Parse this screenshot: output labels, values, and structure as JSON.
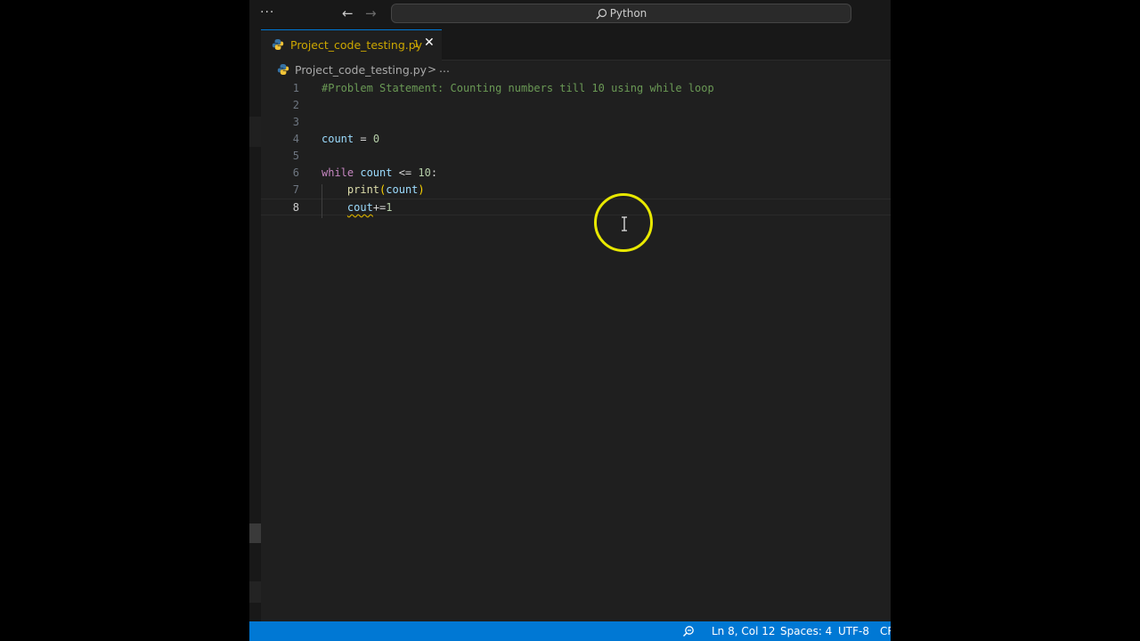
{
  "titlebar": {
    "menu_glyph": "···",
    "command_center": "Python"
  },
  "tabs": [
    {
      "label": "Project_code_testing.py",
      "problems": "1"
    }
  ],
  "breadcrumb": {
    "file": "Project_code_testing.py",
    "separator": ">",
    "more": "..."
  },
  "editor": {
    "active_line": 8,
    "lines": [
      {
        "num": "1",
        "text": "#Problem Statement: Counting numbers till 10 using while loop"
      },
      {
        "num": "2",
        "text": ""
      },
      {
        "num": "3",
        "text": ""
      },
      {
        "num": "4",
        "text": "count = 0"
      },
      {
        "num": "5",
        "text": ""
      },
      {
        "num": "6",
        "text": "while count <= 10:"
      },
      {
        "num": "7",
        "text": "    print(count)"
      },
      {
        "num": "8",
        "text": "    cout+=1"
      }
    ],
    "tokens": {
      "l1_comment": "#Problem Statement: Counting numbers till 10 using while loop",
      "l4_var": "count",
      "l4_op": " = ",
      "l4_num": "0",
      "l6_kw": "while",
      "l6_var": "count",
      "l6_op": " <= ",
      "l6_num": "10",
      "l6_colon": ":",
      "l7_fn": "print",
      "l7_open": "(",
      "l7_var": "count",
      "l7_close": ")",
      "l8_err_var": "cout",
      "l8_op": "+=",
      "l8_num": "1"
    }
  },
  "statusbar": {
    "position": "Ln 8, Col 12",
    "indentation": "Spaces: 4",
    "encoding": "UTF-8",
    "eol": "CR"
  },
  "colors": {
    "accent": "#0078d4",
    "warning": "#cca700",
    "cursor_highlight": "#e8e800"
  }
}
